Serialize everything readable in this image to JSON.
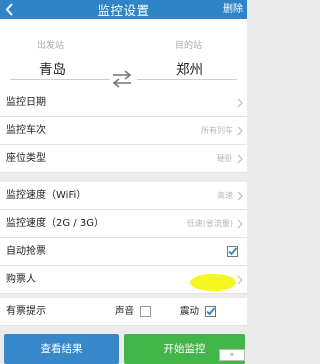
{
  "header": {
    "title": "监控设置",
    "delete_label": "删除"
  },
  "stations": {
    "from_caption": "出发站",
    "from_name": "青岛",
    "to_caption": "目的站",
    "to_name": "郑州"
  },
  "settings": {
    "date": {
      "label": "监控日期",
      "value": ""
    },
    "train": {
      "label": "监控车次",
      "value": "所有列车"
    },
    "seat": {
      "label": "座位类型",
      "value": "硬卧"
    },
    "speed_wifi": {
      "label": "监控速度（WiFi）",
      "value": "高速"
    },
    "speed_mobile": {
      "label": "监控速度（2G / 3G）",
      "value": "低速(省流量)"
    },
    "auto_grab": {
      "label": "自动抢票",
      "checked": true
    },
    "passenger": {
      "label": "购票人",
      "value": ""
    },
    "alert": {
      "label": "有票提示",
      "sound_label": "声音",
      "sound_checked": false,
      "vibrate_label": "震动",
      "vibrate_checked": true
    }
  },
  "buttons": {
    "view_results": "查看结果",
    "start_monitor": "开始监控"
  },
  "colors": {
    "header": "#2e84c6",
    "primary_button": "#3787cb",
    "start_button": "#42b649",
    "highlight": "#f6f621"
  }
}
